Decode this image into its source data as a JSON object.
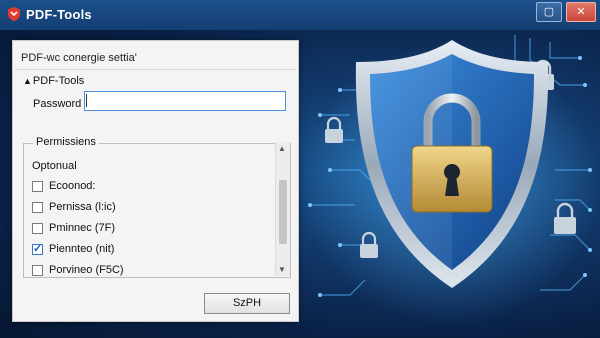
{
  "window": {
    "title": "PDF-Tools",
    "maximize_glyph": "▢",
    "close_glyph": "✕"
  },
  "dialog": {
    "title": "PDF-wc conergie settia'",
    "section_label": "PDF-Tools",
    "section_arrow": "▲",
    "password_label": "Password",
    "password_value": "",
    "permissions_label": "Permissiens",
    "list_header": "Optonual",
    "items": [
      {
        "label": "Ecoonod:",
        "checked": false
      },
      {
        "label": "Pernissa (l:ic)",
        "checked": false
      },
      {
        "label": "Pminnec (7F)",
        "checked": false
      },
      {
        "label": "Piennteo (nit)",
        "checked": true
      },
      {
        "label": "Porvineo (F5C)",
        "checked": false
      }
    ],
    "scroll_up": "▲",
    "scroll_down": "▼",
    "ok_button": "SzPH"
  },
  "icons": {
    "app": "pdf-shield-icon",
    "hero": "shield-padlock-icon",
    "small": "padlock-icon"
  },
  "colors": {
    "accent": "#4a90d8",
    "titlebar": "#1c4f8a",
    "close": "#c9473a",
    "lock_gold": "#d8b45a"
  }
}
